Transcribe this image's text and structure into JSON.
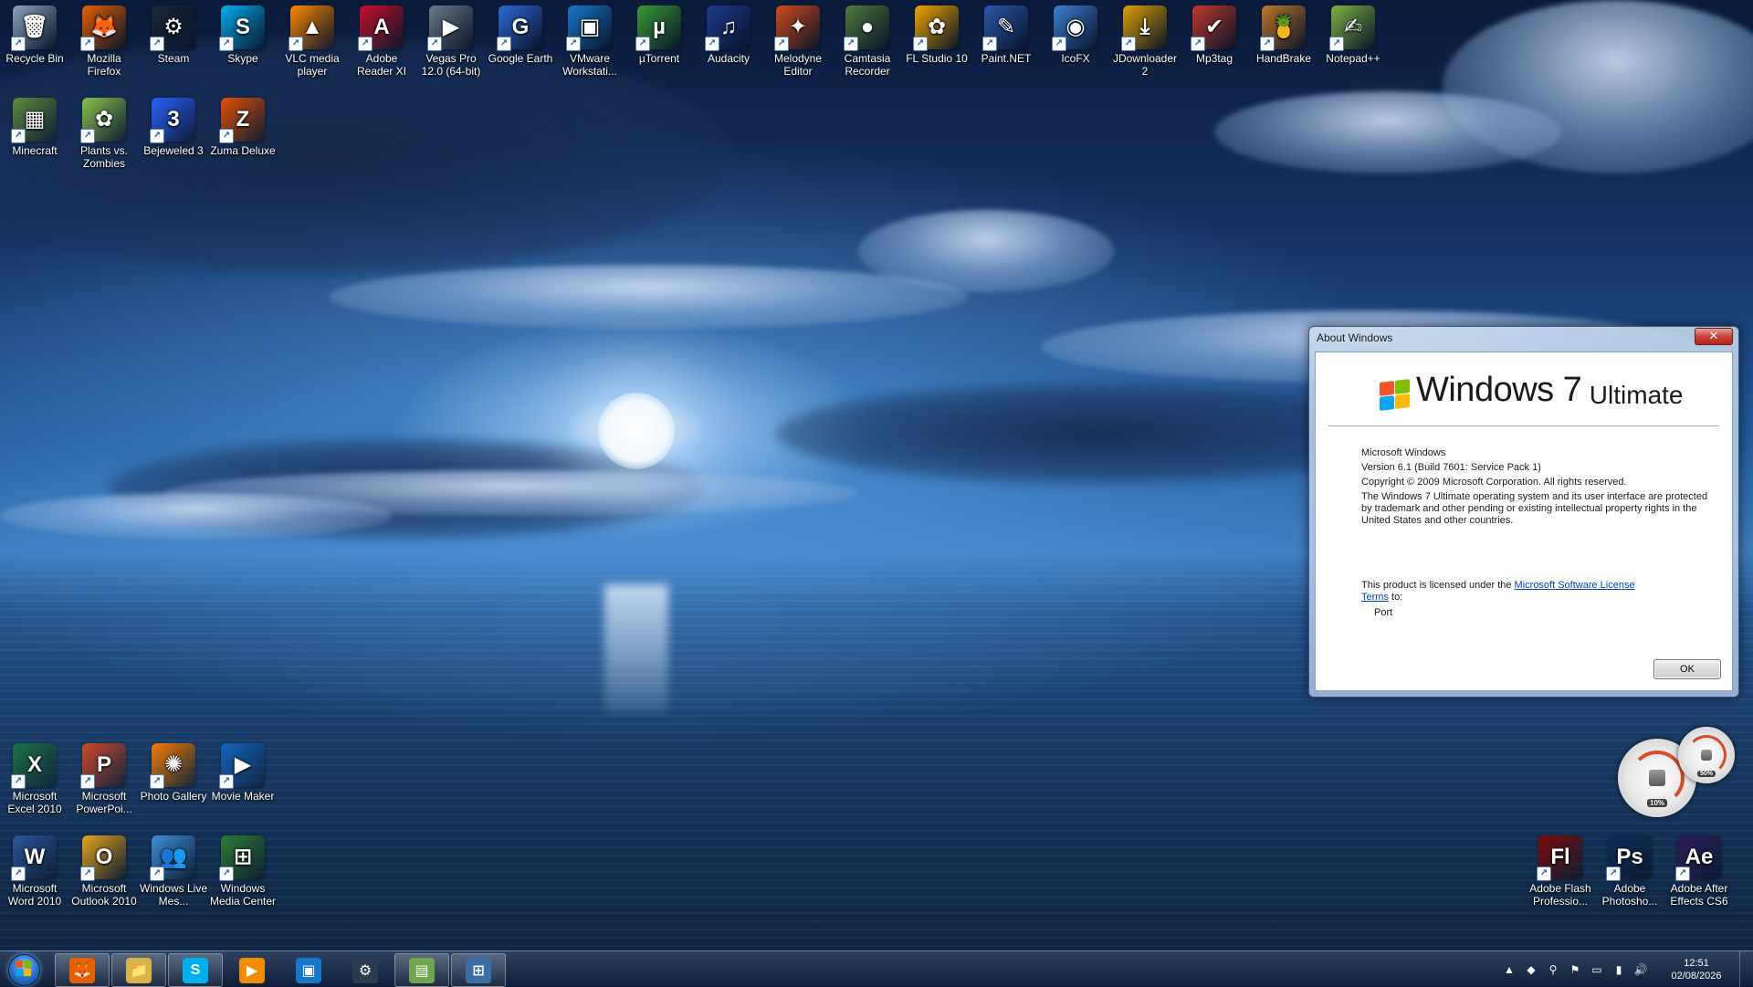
{
  "desktop": {
    "icons_row1": [
      {
        "label": "Recycle Bin",
        "icon": "recycle-bin-icon",
        "color": "#8aa4bf",
        "glyph": "🗑"
      },
      {
        "label": "Mozilla Firefox",
        "icon": "firefox-icon",
        "color": "#e66000",
        "glyph": "🦊"
      },
      {
        "label": "Steam",
        "icon": "steam-icon",
        "color": "#1b2838",
        "glyph": "⚙"
      },
      {
        "label": "Skype",
        "icon": "skype-icon",
        "color": "#00aff0",
        "glyph": "S"
      },
      {
        "label": "VLC media player",
        "icon": "vlc-icon",
        "color": "#ff8800",
        "glyph": "▲"
      },
      {
        "label": "Adobe Reader XI",
        "icon": "adobe-reader-icon",
        "color": "#c8102e",
        "glyph": "A"
      },
      {
        "label": "Vegas Pro 12.0 (64-bit)",
        "icon": "vegas-pro-icon",
        "color": "#6c7a89",
        "glyph": "▶"
      },
      {
        "label": "Google Earth",
        "icon": "google-earth-icon",
        "color": "#2a6ad6",
        "glyph": "G"
      },
      {
        "label": "VMware Workstati...",
        "icon": "vmware-icon",
        "color": "#1778c8",
        "glyph": "▣"
      },
      {
        "label": "µTorrent",
        "icon": "utorrent-icon",
        "color": "#3a9a37",
        "glyph": "µ"
      },
      {
        "label": "Audacity",
        "icon": "audacity-icon",
        "color": "#1c3c8c",
        "glyph": "♫"
      },
      {
        "label": "Melodyne Editor",
        "icon": "melodyne-icon",
        "color": "#d24a1a",
        "glyph": "✦"
      },
      {
        "label": "Camtasia Recorder",
        "icon": "camtasia-icon",
        "color": "#4f7a3a",
        "glyph": "●"
      },
      {
        "label": "FL Studio 10",
        "icon": "fl-studio-icon",
        "color": "#f0a500",
        "glyph": "✿"
      },
      {
        "label": "Paint.NET",
        "icon": "paintnet-icon",
        "color": "#2a5aa8",
        "glyph": "✎"
      },
      {
        "label": "IcoFX",
        "icon": "icofx-icon",
        "color": "#3b80d0",
        "glyph": "◉"
      },
      {
        "label": "JDownloader 2",
        "icon": "jdownloader-icon",
        "color": "#e0a000",
        "glyph": "⤓"
      },
      {
        "label": "Mp3tag",
        "icon": "mp3tag-icon",
        "color": "#c0392b",
        "glyph": "✔"
      },
      {
        "label": "HandBrake",
        "icon": "handbrake-icon",
        "color": "#c0782a",
        "glyph": "🍍"
      },
      {
        "label": "Notepad++",
        "icon": "notepadpp-icon",
        "color": "#7cb342",
        "glyph": "✍"
      }
    ],
    "icons_row2": [
      {
        "label": "Minecraft",
        "icon": "minecraft-icon",
        "color": "#5d8c3a",
        "glyph": "▦"
      },
      {
        "label": "Plants vs. Zombies",
        "icon": "plants-vs-zombies-icon",
        "color": "#8bc34a",
        "glyph": "✿"
      },
      {
        "label": "Bejeweled 3",
        "icon": "bejeweled-icon",
        "color": "#2962ff",
        "glyph": "3"
      },
      {
        "label": "Zuma Deluxe",
        "icon": "zuma-icon",
        "color": "#e65100",
        "glyph": "Z"
      }
    ],
    "icons_bottom_row1": [
      {
        "label": "Microsoft Excel 2010",
        "icon": "excel-icon",
        "color": "#1e7145",
        "glyph": "X"
      },
      {
        "label": "Microsoft PowerPoi...",
        "icon": "powerpoint-icon",
        "color": "#d24726",
        "glyph": "P"
      },
      {
        "label": "Photo Gallery",
        "icon": "photo-gallery-icon",
        "color": "#f57c00",
        "glyph": "✺"
      },
      {
        "label": "Movie Maker",
        "icon": "movie-maker-icon",
        "color": "#1565c0",
        "glyph": "▶"
      }
    ],
    "icons_bottom_row2": [
      {
        "label": "Microsoft Word 2010",
        "icon": "word-icon",
        "color": "#2b579a",
        "glyph": "W"
      },
      {
        "label": "Microsoft Outlook 2010",
        "icon": "outlook-icon",
        "color": "#e8a317",
        "glyph": "O"
      },
      {
        "label": "Windows Live Mes...",
        "icon": "live-messenger-icon",
        "color": "#3d8fd6",
        "glyph": "👥"
      },
      {
        "label": "Windows Media Center",
        "icon": "media-center-icon",
        "color": "#2e7d32",
        "glyph": "⊞"
      }
    ],
    "icons_bottom_right": [
      {
        "label": "Adobe Flash Professio...",
        "icon": "adobe-flash-icon",
        "color": "#7a0a0a",
        "glyph": "Fl"
      },
      {
        "label": "Adobe Photosho...",
        "icon": "adobe-photoshop-icon",
        "color": "#0a2a5a",
        "glyph": "Ps"
      },
      {
        "label": "Adobe After Effects CS6",
        "icon": "adobe-after-effects-icon",
        "color": "#2a1a5a",
        "glyph": "Ae"
      }
    ]
  },
  "dialog": {
    "title": "About Windows",
    "close_glyph": "✕",
    "logo": {
      "windows": "Windows",
      "seven": "7",
      "edition": "Ultimate"
    },
    "product": "Microsoft Windows",
    "version": "Version 6.1 (Build 7601: Service Pack 1)",
    "copyright": "Copyright © 2009 Microsoft Corporation.  All rights reserved.",
    "trademark": "The Windows 7 Ultimate operating system and its user interface are protected by trademark and other pending or existing intellectual property rights in the United States and other countries.",
    "license_prefix": "This product is licensed under the ",
    "license_link": "Microsoft Software License Terms",
    "license_suffix": " to:",
    "owner": "Port",
    "ok_label": "OK"
  },
  "gadget": {
    "cpu_percent": "10%",
    "memory_percent": "50%"
  },
  "taskbar": {
    "pinned": [
      {
        "icon": "firefox-icon",
        "color": "#e66000",
        "glyph": "🦊",
        "active": true
      },
      {
        "icon": "windows-explorer-icon",
        "color": "#d9b24a",
        "glyph": "📁",
        "active": true
      },
      {
        "icon": "skype-icon",
        "color": "#00aff0",
        "glyph": "S",
        "active": true
      },
      {
        "icon": "media-player-icon",
        "color": "#f08c00",
        "glyph": "▶",
        "active": false
      },
      {
        "icon": "vmware-icon",
        "color": "#1778c8",
        "glyph": "▣",
        "active": false
      },
      {
        "icon": "steam-icon",
        "color": "#2a3a4f",
        "glyph": "⚙",
        "active": false
      },
      {
        "icon": "task-manager-icon",
        "color": "#6fa84a",
        "glyph": "▤",
        "active": true
      },
      {
        "icon": "windows-flag-icon",
        "color": "#3a6ea5",
        "glyph": "⊞",
        "active": true
      }
    ],
    "tray_icons": [
      "show-hidden-icons",
      "nvidia-icon",
      "network-sharing-icon",
      "action-center-flag-icon",
      "safely-remove-icon",
      "network-signal-icon",
      "volume-icon"
    ],
    "tray_glyphs": [
      "▲",
      "◆",
      "⚲",
      "⚑",
      "▭",
      "▮",
      "🔊"
    ],
    "time": "12:51",
    "date": "02/08/2026"
  }
}
